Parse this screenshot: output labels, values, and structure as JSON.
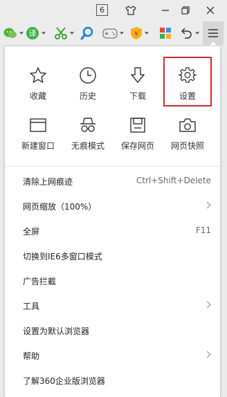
{
  "titlebar": {
    "tab_count": "6"
  },
  "toolbar": {
    "icons": [
      "wechat-icon",
      "translate-icon",
      "screenshot-scissors-icon",
      "search-icon",
      "game-icon",
      "shield-icon",
      "apps-grid-icon",
      "undo-icon",
      "menu-icon"
    ],
    "translate_char": "译",
    "coupon_char": "¥"
  },
  "panel": {
    "top_grid": [
      {
        "label": "收藏",
        "icon": "star-icon"
      },
      {
        "label": "历史",
        "icon": "clock-icon"
      },
      {
        "label": "下载",
        "icon": "download-icon"
      },
      {
        "label": "设置",
        "icon": "gear-icon"
      },
      {
        "label": "新建窗口",
        "icon": "new-window-icon"
      },
      {
        "label": "无痕模式",
        "icon": "incognito-icon"
      },
      {
        "label": "保存网页",
        "icon": "save-icon"
      },
      {
        "label": "网页快照",
        "icon": "camera-icon"
      }
    ],
    "highlight_color": "#d02a2a",
    "menu": [
      {
        "label": "清除上网痕迹",
        "shortcut": "Ctrl+Shift+Delete"
      },
      {
        "label": "网页缩放（100%）",
        "arrow": "›"
      },
      {
        "label": "全屏",
        "shortcut": "F11"
      },
      {
        "label": "切换到IE6多窗口模式"
      },
      {
        "label": "广告拦截"
      },
      {
        "label": "工具",
        "arrow": "›"
      },
      {
        "label": "设置为默认浏览器"
      },
      {
        "label": "帮助",
        "arrow": "›"
      },
      {
        "label": "了解360企业版浏览器"
      }
    ]
  }
}
